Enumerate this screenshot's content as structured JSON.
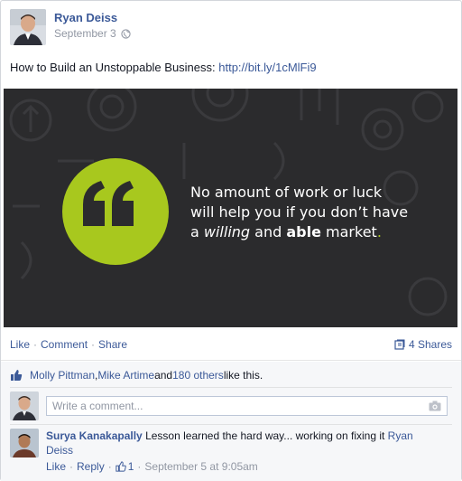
{
  "post": {
    "author": "Ryan Deiss",
    "date": "September 3",
    "message_text": "How to Build an Unstoppable Business: ",
    "message_link": "http://bit.ly/1cMlFi9"
  },
  "media": {
    "quote_line1": "No amount of work or luck",
    "quote_line2": "will help you if you don’t have",
    "quote_line3_a": "a ",
    "quote_line3_willing": "willing",
    "quote_line3_and": " and ",
    "quote_line3_able": "able",
    "quote_line3_market": " market",
    "quote_line3_period": ".",
    "accent_color": "#a8c81e",
    "background_color": "#2b2b2d",
    "icon": "quote-mark-icon"
  },
  "actions": {
    "like": "Like",
    "comment": "Comment",
    "share": "Share",
    "shares_count": "4 Shares"
  },
  "likes": {
    "name1": "Molly Pittman",
    "separator": ", ",
    "name2": "Mike Artime",
    "and_text": " and ",
    "others": "180 others",
    "suffix": " like this."
  },
  "comment_box": {
    "placeholder": "Write a comment..."
  },
  "comment": {
    "author": "Surya Kanakapally",
    "text": " Lesson learned the hard way... working on fixing it ",
    "mention": "Ryan Deiss",
    "like": "Like",
    "reply": "Reply",
    "like_count": "1",
    "timestamp": "September 5 at 9:05am"
  },
  "colors": {
    "link": "#3b5998",
    "muted": "#9197a3"
  }
}
